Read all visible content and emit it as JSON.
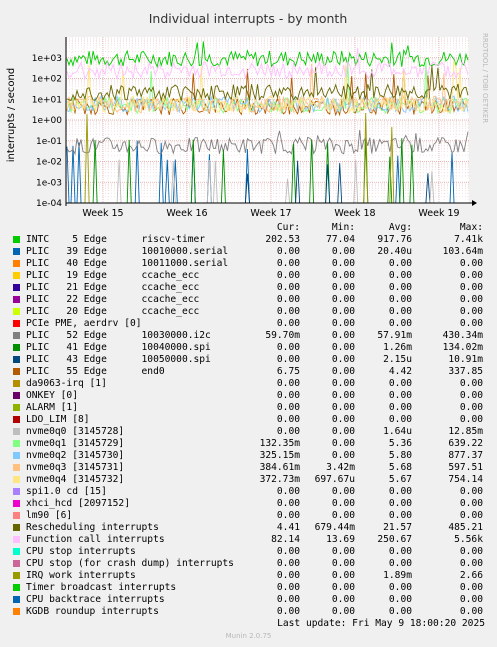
{
  "chart_data": {
    "type": "line",
    "title": "Individual interrupts - by month",
    "ylabel": "interrupts / second",
    "yscale": "log",
    "ylim": [
      0.0001,
      10000
    ],
    "yticks": [
      "1e-04",
      "1e-03",
      "1e-02",
      "1e-01",
      "1e+00",
      "1e+01",
      "1e+02",
      "1e+03"
    ],
    "xticks": [
      "Week 15",
      "Week 16",
      "Week 17",
      "Week 18",
      "Week 19"
    ],
    "grid": true,
    "side_text": "RRDTOOL / TOBI OETIKER",
    "colors": {
      "green": "#00cc00",
      "blue": "#0066b3",
      "orange": "#ff8000",
      "yellow": "#ffcc00",
      "navy": "#330099",
      "purple": "#990099",
      "lime": "#ccff00",
      "red": "#ff0000",
      "gray": "#808080",
      "darkgreen": "#008f00",
      "teal": "#00487d",
      "brown": "#b35a00",
      "olive": "#b38f00",
      "darkpurple": "#6b006b",
      "olivegreen": "#8fb300",
      "darkred": "#b30000",
      "silver": "#bebebe",
      "lightgreen": "#80ff80",
      "lightblue": "#80c9ff",
      "peach": "#ffc080",
      "lightyellow": "#ffe680",
      "lavender": "#aa80ff",
      "pink": "#ee00cc",
      "salmon": "#ff8080",
      "darkolive": "#666600",
      "lightpink": "#ffbfff",
      "cyan": "#00ffcc",
      "mauve": "#cc6699",
      "khaki": "#999900"
    },
    "columns": [
      "Cur:",
      "Min:",
      "Avg:",
      "Max:"
    ],
    "series": [
      {
        "name": "INTC    5 Edge      riscv-timer",
        "color": "#00cc00",
        "cur": "202.53",
        "min": "77.04",
        "avg": "917.76",
        "max": "7.41k"
      },
      {
        "name": "PLIC   39 Edge      10010000.serial",
        "color": "#0066b3",
        "cur": "0.00",
        "min": "0.00",
        "avg": "20.40u",
        "max": "103.64m"
      },
      {
        "name": "PLIC   40 Edge      10011000.serial",
        "color": "#ff8000",
        "cur": "0.00",
        "min": "0.00",
        "avg": "0.00",
        "max": "0.00"
      },
      {
        "name": "PLIC   19 Edge      ccache_ecc",
        "color": "#ffcc00",
        "cur": "0.00",
        "min": "0.00",
        "avg": "0.00",
        "max": "0.00"
      },
      {
        "name": "PLIC   21 Edge      ccache_ecc",
        "color": "#330099",
        "cur": "0.00",
        "min": "0.00",
        "avg": "0.00",
        "max": "0.00"
      },
      {
        "name": "PLIC   22 Edge      ccache_ecc",
        "color": "#990099",
        "cur": "0.00",
        "min": "0.00",
        "avg": "0.00",
        "max": "0.00"
      },
      {
        "name": "PLIC   20 Edge      ccache_ecc",
        "color": "#ccff00",
        "cur": "0.00",
        "min": "0.00",
        "avg": "0.00",
        "max": "0.00"
      },
      {
        "name": "PCIe PME, aerdrv [0]",
        "color": "#ff0000",
        "cur": "0.00",
        "min": "0.00",
        "avg": "0.00",
        "max": "0.00"
      },
      {
        "name": "PLIC   52 Edge      10030000.i2c",
        "color": "#808080",
        "cur": "59.70m",
        "min": "0.00",
        "avg": "57.91m",
        "max": "430.34m"
      },
      {
        "name": "PLIC   41 Edge      10040000.spi",
        "color": "#008f00",
        "cur": "0.00",
        "min": "0.00",
        "avg": "1.26m",
        "max": "134.02m"
      },
      {
        "name": "PLIC   43 Edge      10050000.spi",
        "color": "#00487d",
        "cur": "0.00",
        "min": "0.00",
        "avg": "2.15u",
        "max": "10.91m"
      },
      {
        "name": "PLIC   55 Edge      end0",
        "color": "#b35a00",
        "cur": "6.75",
        "min": "0.00",
        "avg": "4.42",
        "max": "337.85"
      },
      {
        "name": "da9063-irq [1]",
        "color": "#b38f00",
        "cur": "0.00",
        "min": "0.00",
        "avg": "0.00",
        "max": "0.00"
      },
      {
        "name": "ONKEY [0]",
        "color": "#6b006b",
        "cur": "0.00",
        "min": "0.00",
        "avg": "0.00",
        "max": "0.00"
      },
      {
        "name": "ALARM [1]",
        "color": "#8fb300",
        "cur": "0.00",
        "min": "0.00",
        "avg": "0.00",
        "max": "0.00"
      },
      {
        "name": "LDO_LIM [8]",
        "color": "#b30000",
        "cur": "0.00",
        "min": "0.00",
        "avg": "0.00",
        "max": "0.00"
      },
      {
        "name": "nvme0q0 [3145728]",
        "color": "#bebebe",
        "cur": "0.00",
        "min": "0.00",
        "avg": "1.64u",
        "max": "12.85m"
      },
      {
        "name": "nvme0q1 [3145729]",
        "color": "#80ff80",
        "cur": "132.35m",
        "min": "0.00",
        "avg": "5.36",
        "max": "639.22"
      },
      {
        "name": "nvme0q2 [3145730]",
        "color": "#80c9ff",
        "cur": "325.15m",
        "min": "0.00",
        "avg": "5.80",
        "max": "877.37"
      },
      {
        "name": "nvme0q3 [3145731]",
        "color": "#ffc080",
        "cur": "384.61m",
        "min": "3.42m",
        "avg": "5.68",
        "max": "597.51"
      },
      {
        "name": "nvme0q4 [3145732]",
        "color": "#ffe680",
        "cur": "372.73m",
        "min": "697.67u",
        "avg": "5.67",
        "max": "754.14"
      },
      {
        "name": "spi1.0 cd [15]",
        "color": "#aa80ff",
        "cur": "0.00",
        "min": "0.00",
        "avg": "0.00",
        "max": "0.00"
      },
      {
        "name": "xhci_hcd [2097152]",
        "color": "#ee00cc",
        "cur": "0.00",
        "min": "0.00",
        "avg": "0.00",
        "max": "0.00"
      },
      {
        "name": "lm90 [6]",
        "color": "#ff8080",
        "cur": "0.00",
        "min": "0.00",
        "avg": "0.00",
        "max": "0.00"
      },
      {
        "name": "Rescheduling interrupts",
        "color": "#666600",
        "cur": "4.41",
        "min": "679.44m",
        "avg": "21.57",
        "max": "485.21"
      },
      {
        "name": "Function call interrupts",
        "color": "#ffbfff",
        "cur": "82.14",
        "min": "13.69",
        "avg": "250.67",
        "max": "5.56k"
      },
      {
        "name": "CPU stop interrupts",
        "color": "#00ffcc",
        "cur": "0.00",
        "min": "0.00",
        "avg": "0.00",
        "max": "0.00"
      },
      {
        "name": "CPU stop (for crash dump) interrupts",
        "color": "#cc6699",
        "cur": "0.00",
        "min": "0.00",
        "avg": "0.00",
        "max": "0.00"
      },
      {
        "name": "IRQ work interrupts",
        "color": "#999900",
        "cur": "0.00",
        "min": "0.00",
        "avg": "1.89m",
        "max": "2.66"
      },
      {
        "name": "Timer broadcast interrupts",
        "color": "#00cc00",
        "cur": "0.00",
        "min": "0.00",
        "avg": "0.00",
        "max": "0.00"
      },
      {
        "name": "CPU backtrace interrupts",
        "color": "#0066b3",
        "cur": "0.00",
        "min": "0.00",
        "avg": "0.00",
        "max": "0.00"
      },
      {
        "name": "KGDB roundup interrupts",
        "color": "#ff8000",
        "cur": "0.00",
        "min": "0.00",
        "avg": "0.00",
        "max": "0.00"
      }
    ]
  },
  "footer": {
    "last_update": "Last update: Fri May  9 18:00:20 2025",
    "munin": "Munin 2.0.75"
  }
}
